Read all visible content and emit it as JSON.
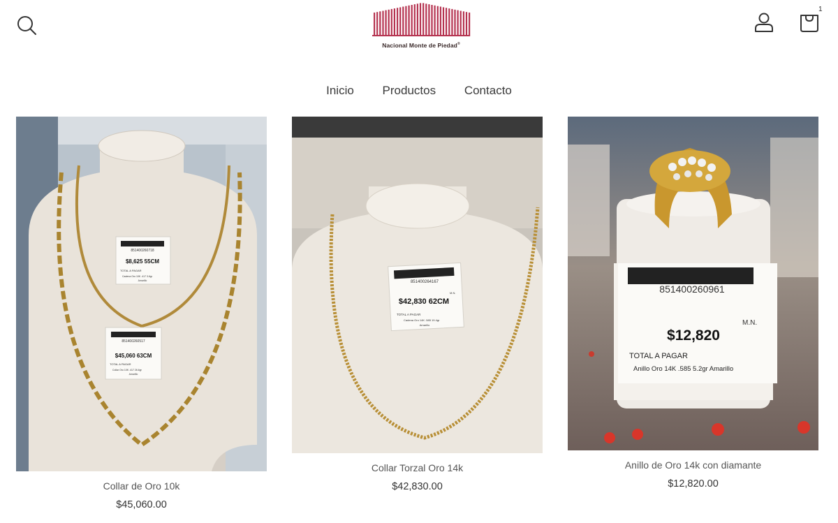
{
  "header": {
    "logo_text": "Nacional Monte de Piedad",
    "logo_registered": "®",
    "cart_count": "1",
    "icons": [
      "search-icon",
      "account-icon",
      "cart-icon"
    ]
  },
  "nav": {
    "items": [
      "Inicio",
      "Productos",
      "Contacto"
    ]
  },
  "products": [
    {
      "title": "Collar de Oro 10k",
      "price": "$45,060.00",
      "tag1": {
        "barcode_no": "851400260718",
        "price": "$8,625 55CM",
        "line1": "TOTAL A PAGAR",
        "line2": "Cadena Oro 10K .417 3.6gr",
        "line3": "Amarillo"
      },
      "tag2": {
        "barcode_no": "851400260517",
        "price": "$45,060 63CM",
        "line1": "TOTAL A PAGAR",
        "line2": "Collar Oro 10K .417 26.6gr",
        "line3": "Amarillo"
      }
    },
    {
      "title": "Collar Torzal Oro 14k",
      "price": "$42,830.00",
      "tag": {
        "barcode_no": "851400264167",
        "price": "$42,830 62CM",
        "currency": "M.N.",
        "line1": "TOTAL A PAGAR",
        "line2": "Cadena Oro 14K .585 19.4gr",
        "line3": "Amarillo"
      }
    },
    {
      "title": "Anillo de Oro 14k con diamante",
      "price": "$12,820.00",
      "tag": {
        "barcode_no": "851400260961",
        "price": "$12,820",
        "currency": "M.N.",
        "line1": "TOTAL A PAGAR",
        "line2": "Anillo Oro 14K .585 5.2gr Amarillo"
      }
    }
  ],
  "colors": {
    "brand": "#b5324f",
    "text": "#333333",
    "muted": "#555555"
  }
}
